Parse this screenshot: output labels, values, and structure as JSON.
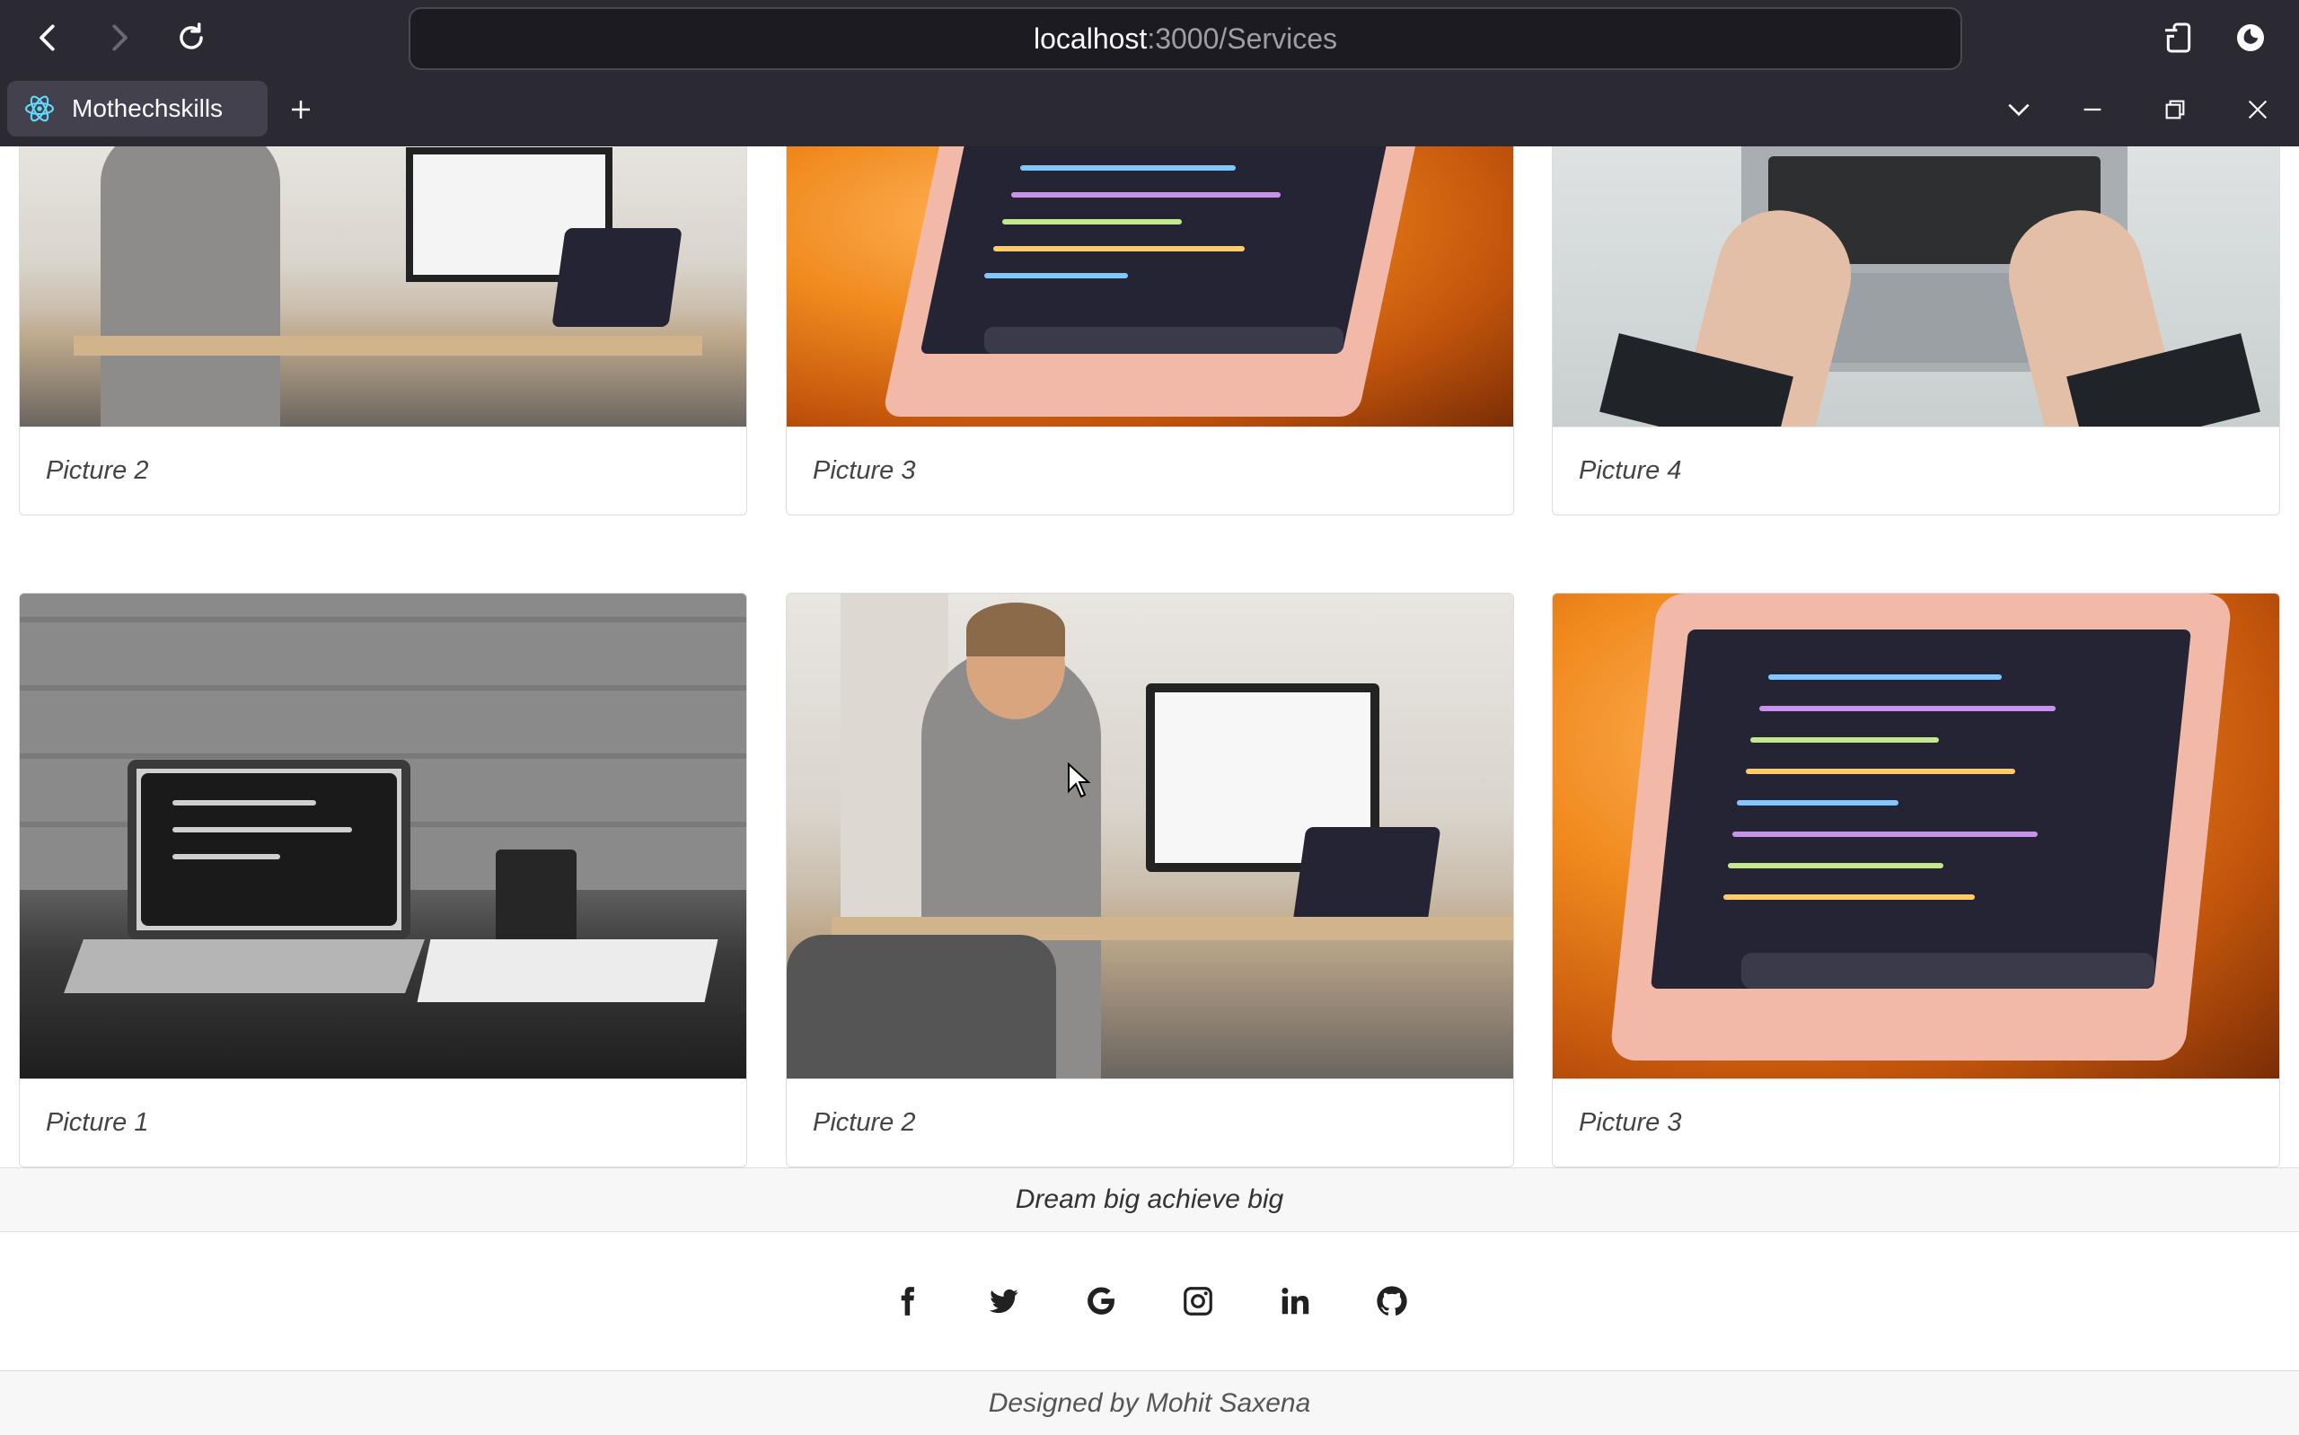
{
  "browser": {
    "url_host": "localhost",
    "url_path": ":3000/Services",
    "tab_title": "Mothechskills",
    "new_tab_label": "+"
  },
  "gallery": {
    "row1": [
      {
        "caption": "Picture 2",
        "photo": "person-at-desk"
      },
      {
        "caption": "Picture 3",
        "photo": "laptop-code-orange"
      },
      {
        "caption": "Picture 4",
        "photo": "hands-on-keyboard"
      }
    ],
    "row2": [
      {
        "caption": "Picture 1",
        "photo": "laptop-brick-wall-bw"
      },
      {
        "caption": "Picture 2",
        "photo": "person-at-desk"
      },
      {
        "caption": "Picture 3",
        "photo": "laptop-code-orange"
      }
    ]
  },
  "footer": {
    "tagline": "Dream big achieve big",
    "credit": "Designed by Mohit Saxena",
    "social": [
      "facebook-icon",
      "twitter-icon",
      "google-icon",
      "instagram-icon",
      "linkedin-icon",
      "github-icon"
    ]
  },
  "colors": {
    "chrome_bg": "#2b2a33",
    "urlbar_bg": "#1c1b22",
    "tab_bg": "#42414d",
    "footer_bg": "#f7f7f7"
  }
}
